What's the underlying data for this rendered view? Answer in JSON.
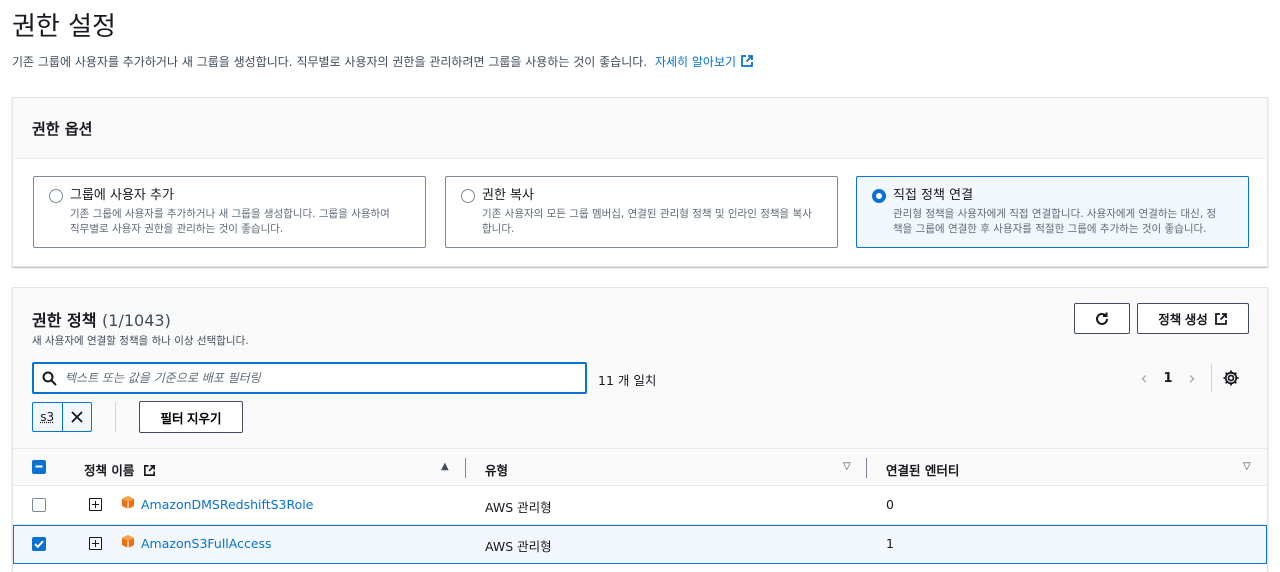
{
  "page": {
    "title": "권한 설정",
    "description": "기존 그룹에 사용자를 추가하거나 새 그룹을 생성합니다. 직무별로 사용자의 권한을 관리하려면 그룹을 사용하는 것이 좋습니다.",
    "learn_more": "자세히 알아보기"
  },
  "options_panel": {
    "title": "권한 옵션",
    "options": [
      {
        "title": "그룹에 사용자 추가",
        "desc_line1": "기존 그룹에 사용자를 추가하거나 새 그룹을 생성합니다. 그룹을 사용하여",
        "desc_line2": "직무별로 사용자 권한을 관리하는 것이 좋습니다.",
        "selected": false
      },
      {
        "title": "권한 복사",
        "desc_line1": "기존 사용자의 모든 그룹 멤버십, 연결된 관리형 정책 및 인라인 정책을 복사",
        "desc_line2": "합니다.",
        "selected": false
      },
      {
        "title": "직접 정책 연결",
        "desc_line1": "관리형 정책을 사용자에게 직접 연결합니다. 사용자에게 연결하는 대신, 정",
        "desc_line2": "책을 그룹에 연결한 후 사용자를 적절한 그룹에 추가하는 것이 좋습니다.",
        "selected": true
      }
    ]
  },
  "policies": {
    "title": "권한 정책",
    "count": "(1/1043)",
    "description": "새 사용자에 연결할 정책을 하나 이상 선택합니다.",
    "create_button": "정책 생성",
    "search_placeholder": "텍스트 또는 값을 기준으로 배포 필터링",
    "match_text": "11 개 일치",
    "page_number": "1",
    "filter_token": "s3",
    "clear_filter": "필터 지우기",
    "columns": [
      "정책 이름",
      "유형",
      "연결된 엔터티"
    ],
    "rows": [
      {
        "name": "AmazonDMSRedshiftS3Role",
        "type": "AWS 관리형",
        "entities": "0",
        "checked": false
      },
      {
        "name": "AmazonS3FullAccess",
        "type": "AWS 관리형",
        "entities": "1",
        "checked": true
      }
    ]
  },
  "colors": {
    "accent": "#0972d3",
    "text": "#16191f",
    "muted": "#5f6b7a",
    "aws_orange": "#ec7211"
  }
}
